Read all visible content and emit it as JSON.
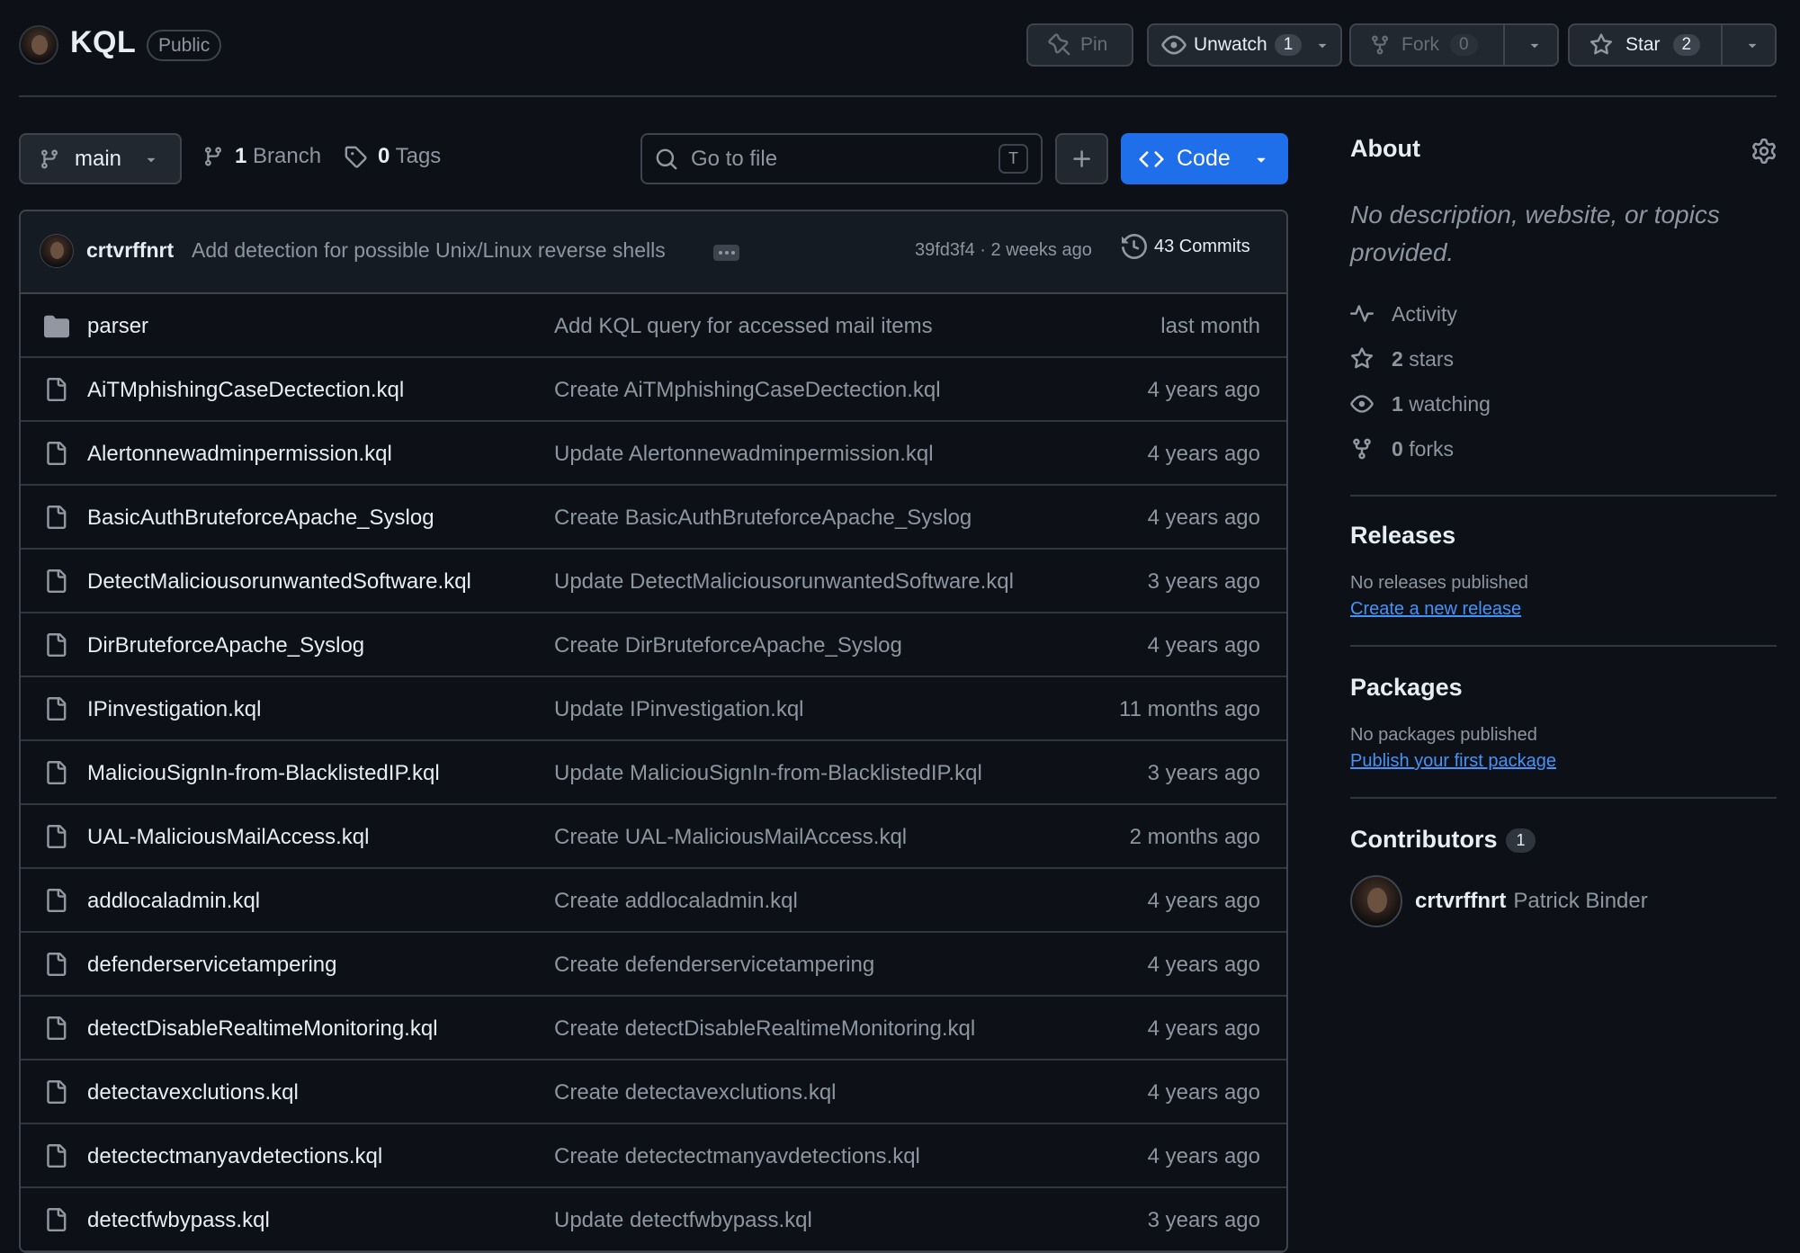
{
  "repo": {
    "name": "KQL",
    "visibility": "Public"
  },
  "header_actions": {
    "pin_label": "Pin",
    "unwatch_label": "Unwatch",
    "watch_count": "1",
    "fork_label": "Fork",
    "fork_count": "0",
    "star_label": "Star",
    "star_count": "2"
  },
  "toolbar": {
    "branch": "main",
    "branches_count": "1",
    "branches_label": "Branch",
    "tags_count": "0",
    "tags_label": "Tags",
    "goto_placeholder": "Go to file",
    "goto_shortcut": "T",
    "code_label": "Code"
  },
  "latest_commit": {
    "author": "crtvrffnrt",
    "message": "Add detection for possible Unix/Linux reverse shells",
    "hash": "39fd3f4",
    "when": "2 weeks ago",
    "commits_label": "43 Commits"
  },
  "files": [
    {
      "name": "parser",
      "type": "dir",
      "message": "Add KQL query for accessed mail items",
      "date": "last month"
    },
    {
      "name": "AiTMphishingCaseDectection.kql",
      "type": "file",
      "message": "Create AiTMphishingCaseDectection.kql",
      "date": "4 years ago"
    },
    {
      "name": "Alertonnewadminpermission.kql",
      "type": "file",
      "message": "Update Alertonnewadminpermission.kql",
      "date": "4 years ago"
    },
    {
      "name": "BasicAuthBruteforceApache_Syslog",
      "type": "file",
      "message": "Create BasicAuthBruteforceApache_Syslog",
      "date": "4 years ago"
    },
    {
      "name": "DetectMaliciousorunwantedSoftware.kql",
      "type": "file",
      "message": "Update DetectMaliciousorunwantedSoftware.kql",
      "date": "3 years ago"
    },
    {
      "name": "DirBruteforceApache_Syslog",
      "type": "file",
      "message": "Create DirBruteforceApache_Syslog",
      "date": "4 years ago"
    },
    {
      "name": "IPinvestigation.kql",
      "type": "file",
      "message": "Update IPinvestigation.kql",
      "date": "11 months ago"
    },
    {
      "name": "MaliciouSignIn-from-BlacklistedIP.kql",
      "type": "file",
      "message": "Update MaliciouSignIn-from-BlacklistedIP.kql",
      "date": "3 years ago"
    },
    {
      "name": "UAL-MaliciousMailAccess.kql",
      "type": "file",
      "message": "Create UAL-MaliciousMailAccess.kql",
      "date": "2 months ago"
    },
    {
      "name": "addlocaladmin.kql",
      "type": "file",
      "message": "Create addlocaladmin.kql",
      "date": "4 years ago"
    },
    {
      "name": "defenderservicetampering",
      "type": "file",
      "message": "Create defenderservicetampering",
      "date": "4 years ago"
    },
    {
      "name": "detectDisableRealtimeMonitoring.kql",
      "type": "file",
      "message": "Create detectDisableRealtimeMonitoring.kql",
      "date": "4 years ago"
    },
    {
      "name": "detectavexclutions.kql",
      "type": "file",
      "message": "Create detectavexclutions.kql",
      "date": "4 years ago"
    },
    {
      "name": "detectectmanyavdetections.kql",
      "type": "file",
      "message": "Create detectectmanyavdetections.kql",
      "date": "4 years ago"
    },
    {
      "name": "detectfwbypass.kql",
      "type": "file",
      "message": "Update detectfwbypass.kql",
      "date": "3 years ago"
    }
  ],
  "about": {
    "heading": "About",
    "description": "No description, website, or topics provided.",
    "activity_label": "Activity",
    "stars_count": "2",
    "stars_label": "stars",
    "watching_count": "1",
    "watching_label": "watching",
    "forks_count": "0",
    "forks_label": "forks"
  },
  "releases": {
    "heading": "Releases",
    "empty_text": "No releases published",
    "link": "Create a new release"
  },
  "packages": {
    "heading": "Packages",
    "empty_text": "No packages published",
    "link": "Publish your first package"
  },
  "contributors": {
    "heading": "Contributors",
    "count": "1",
    "items": [
      {
        "login": "crtvrffnrt",
        "name": "Patrick Binder"
      }
    ]
  },
  "colors": {
    "background": "#0d1117",
    "border": "#3d444d",
    "accent": "#1f6feb",
    "link": "#4493f8",
    "muted": "#8d96a0"
  }
}
